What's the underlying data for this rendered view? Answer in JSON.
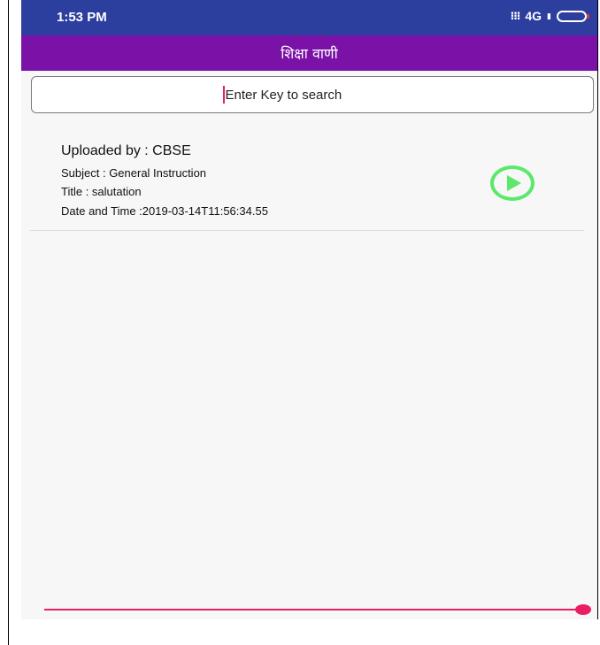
{
  "status_bar": {
    "time": "1:53 PM",
    "network": "4G",
    "icons": [
      "signal-dots-icon",
      "cell-signal-icon",
      "battery-icon"
    ]
  },
  "app_bar": {
    "title": "शिक्षा वाणी",
    "color": "#7b12a8"
  },
  "search": {
    "placeholder": "Enter Key to search",
    "value": ""
  },
  "items": [
    {
      "uploaded_by": "Uploaded by : CBSE",
      "subject": "Subject : General Instruction",
      "title": "Title : salutation",
      "date_time": "Date and Time :2019-03-14T11:56:34.55",
      "action_icon": "play-circle-icon"
    }
  ],
  "player": {
    "progress": 1.0,
    "color": "#e91e63"
  },
  "colors": {
    "status_bar": "#2c3e9e",
    "play_button": "#5ce86a"
  }
}
